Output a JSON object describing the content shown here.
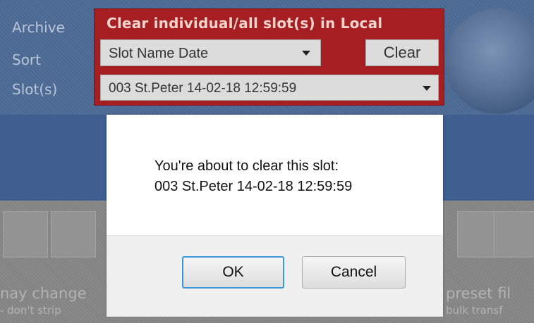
{
  "labels": {
    "archive": "Archive",
    "sort": "Sort",
    "slots": "Slot(s)"
  },
  "panel": {
    "title": "Clear individual/all slot(s) in Local",
    "sort_value": "Slot Name Date",
    "clear_label": "Clear",
    "slot_value": "003 St.Peter 14-02-18 12:59:59"
  },
  "background_text": {
    "left_line1": "nay change",
    "left_line2": "- don't strip",
    "right_line1": "preset fil",
    "right_line2": "bulk transf"
  },
  "dialog": {
    "message_line1": "You're about to clear this slot:",
    "message_line2": "003 St.Peter 14-02-18 12:59:59",
    "ok_label": "OK",
    "cancel_label": "Cancel"
  },
  "colors": {
    "panel_red": "#a51e22",
    "band_blue": "#3f5f91",
    "ok_focus": "#3c97d6"
  }
}
